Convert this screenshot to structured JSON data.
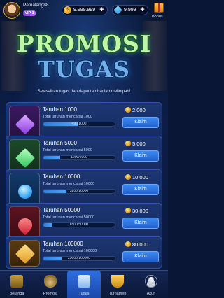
{
  "header": {
    "username": "Petualang88",
    "vip_badge": "VIP 1",
    "coins": "9.999.999",
    "gems": "9.999",
    "plus_symbol": "+",
    "bonus_label": "Bonus"
  },
  "title": {
    "line1": "PROMOSI",
    "line2": "TUGAS",
    "subtitle": "Selesaikan tugas dan dapatkan hadiah melimpah!"
  },
  "tasks": [
    {
      "name": "Taruhan 1000",
      "desc": "Total taruhan mencapai 1000",
      "progress_text": "490/1000",
      "progress": 0.49,
      "reward": "2.000",
      "button": "Klaim",
      "gem": "purple"
    },
    {
      "name": "Taruhan 5000",
      "desc": "Total taruhan mencapai 5000",
      "progress_text": "1200/5000",
      "progress": 0.24,
      "reward": "5.000",
      "button": "Klaim",
      "gem": "green"
    },
    {
      "name": "Taruhan 10000",
      "desc": "Total taruhan mencapai 10000",
      "progress_text": "3200/10000",
      "progress": 0.32,
      "reward": "10.000",
      "button": "Klaim",
      "gem": "blue"
    },
    {
      "name": "Taruhan 50000",
      "desc": "Total taruhan mencapai 50000",
      "progress_text": "6500/50000",
      "progress": 0.13,
      "reward": "30.000",
      "button": "Klaim",
      "gem": "red"
    },
    {
      "name": "Taruhan 100000",
      "desc": "Total taruhan mencapai 100000",
      "progress_text": "25000/100000",
      "progress": 0.25,
      "reward": "80.000",
      "button": "Klaim",
      "gem": "gold"
    }
  ],
  "nav": [
    {
      "label": "Beranda",
      "icon": "slot-machine-icon",
      "active": false
    },
    {
      "label": "Promosi",
      "icon": "money-bag-icon",
      "active": false
    },
    {
      "label": "Tugas",
      "icon": "task-list-icon",
      "active": true
    },
    {
      "label": "Turnamen",
      "icon": "trophy-icon",
      "active": false
    },
    {
      "label": "Akun",
      "icon": "user-icon",
      "active": false
    }
  ]
}
